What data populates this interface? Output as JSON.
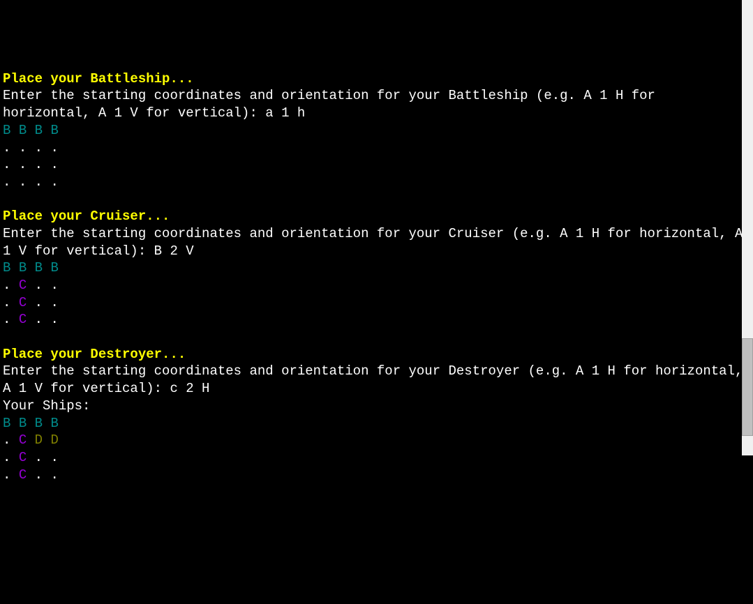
{
  "sections": [
    {
      "header": "Place your Battleship...",
      "prompt_prefix": "Enter the starting coordinates and orientation for your Battleship (e.g. A 1 H for horizontal, A 1 V for vertical): ",
      "input": "a 1 h",
      "board": [
        [
          {
            "ch": "B",
            "c": "teal"
          },
          {
            "ch": "B",
            "c": "teal"
          },
          {
            "ch": "B",
            "c": "teal"
          },
          {
            "ch": "B",
            "c": "teal"
          }
        ],
        [
          {
            "ch": ".",
            "c": "white"
          },
          {
            "ch": ".",
            "c": "white"
          },
          {
            "ch": ".",
            "c": "white"
          },
          {
            "ch": ".",
            "c": "white"
          }
        ],
        [
          {
            "ch": ".",
            "c": "white"
          },
          {
            "ch": ".",
            "c": "white"
          },
          {
            "ch": ".",
            "c": "white"
          },
          {
            "ch": ".",
            "c": "white"
          }
        ],
        [
          {
            "ch": ".",
            "c": "white"
          },
          {
            "ch": ".",
            "c": "white"
          },
          {
            "ch": ".",
            "c": "white"
          },
          {
            "ch": ".",
            "c": "white"
          }
        ]
      ]
    },
    {
      "header": "Place your Cruiser...",
      "prompt_prefix": "Enter the starting coordinates and orientation for your Cruiser (e.g. A 1 H for horizontal, A 1 V for vertical): ",
      "input": "B 2 V",
      "board": [
        [
          {
            "ch": "B",
            "c": "teal"
          },
          {
            "ch": "B",
            "c": "teal"
          },
          {
            "ch": "B",
            "c": "teal"
          },
          {
            "ch": "B",
            "c": "teal"
          }
        ],
        [
          {
            "ch": ".",
            "c": "white"
          },
          {
            "ch": "C",
            "c": "purple"
          },
          {
            "ch": ".",
            "c": "white"
          },
          {
            "ch": ".",
            "c": "white"
          }
        ],
        [
          {
            "ch": ".",
            "c": "white"
          },
          {
            "ch": "C",
            "c": "purple"
          },
          {
            "ch": ".",
            "c": "white"
          },
          {
            "ch": ".",
            "c": "white"
          }
        ],
        [
          {
            "ch": ".",
            "c": "white"
          },
          {
            "ch": "C",
            "c": "purple"
          },
          {
            "ch": ".",
            "c": "white"
          },
          {
            "ch": ".",
            "c": "white"
          }
        ]
      ]
    },
    {
      "header": "Place your Destroyer...",
      "prompt_prefix": "Enter the starting coordinates and orientation for your Destroyer (e.g. A 1 H for horizontal, A 1 V for vertical): ",
      "input": "c 2 H",
      "post_label": "Your Ships:",
      "board": [
        [
          {
            "ch": "B",
            "c": "teal"
          },
          {
            "ch": "B",
            "c": "teal"
          },
          {
            "ch": "B",
            "c": "teal"
          },
          {
            "ch": "B",
            "c": "teal"
          }
        ],
        [
          {
            "ch": ".",
            "c": "white"
          },
          {
            "ch": "C",
            "c": "purple"
          },
          {
            "ch": "D",
            "c": "darkyellow"
          },
          {
            "ch": "D",
            "c": "darkyellow"
          }
        ],
        [
          {
            "ch": ".",
            "c": "white"
          },
          {
            "ch": "C",
            "c": "purple"
          },
          {
            "ch": ".",
            "c": "white"
          },
          {
            "ch": ".",
            "c": "white"
          }
        ],
        [
          {
            "ch": ".",
            "c": "white"
          },
          {
            "ch": "C",
            "c": "purple"
          },
          {
            "ch": ".",
            "c": "white"
          },
          {
            "ch": ".",
            "c": "white"
          }
        ]
      ]
    }
  ]
}
